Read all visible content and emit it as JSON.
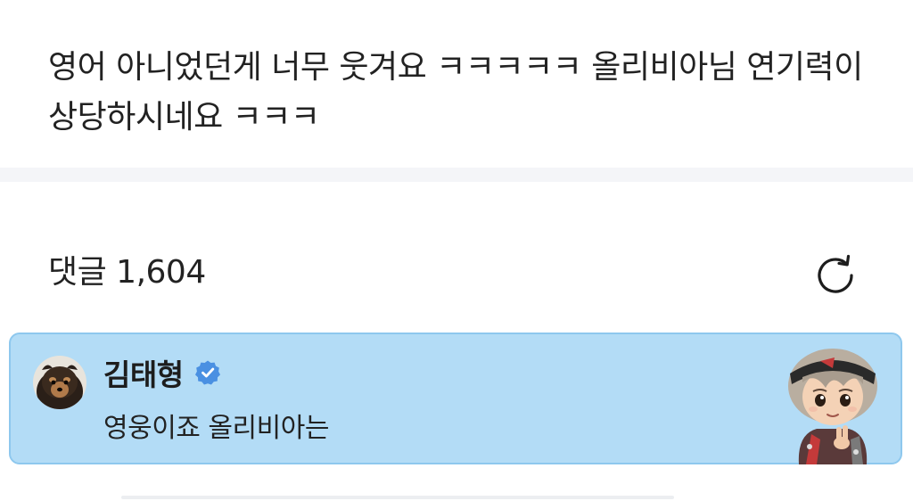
{
  "post": {
    "text": "영어 아니었던게 너무 웃겨요 ㅋㅋㅋㅋㅋ 올리비아님 연기력이 상당하시네요 ㅋㅋㅋ"
  },
  "comments": {
    "title": "댓글 1,604",
    "refresh_icon": "refresh-icon"
  },
  "pinned_comment": {
    "author": "김태형",
    "verified_icon": "verified-badge-icon",
    "text": "영웅이죠 올리비아는",
    "colors": {
      "background": "#b3dcf6",
      "border": "#8ec8ee",
      "verified": "#4a90e2"
    }
  }
}
